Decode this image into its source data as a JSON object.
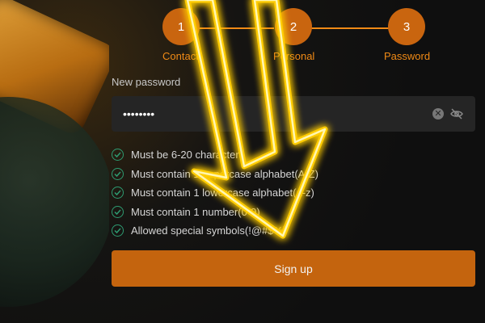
{
  "steps": [
    {
      "number": "1",
      "label": "Contact"
    },
    {
      "number": "2",
      "label": "Personal"
    },
    {
      "number": "3",
      "label": "Password"
    }
  ],
  "form": {
    "password_label": "New password",
    "password_value": "••••••••",
    "rules": [
      "Must be 6-20 characters",
      "Must contain 1 uppercase alphabet(A-Z)",
      "Must contain 1 lowercase alphabet(a-z)",
      "Must contain 1 number(0-9)",
      "Allowed special symbols(!@#$%)"
    ],
    "submit_label": "Sign up"
  },
  "colors": {
    "accent": "#c4640e",
    "step_label": "#f08a16",
    "check": "#2e9b71",
    "arrow_glow": "#ffcc00"
  },
  "icons": {
    "clear": "clear-icon",
    "visibility": "eye-off-icon",
    "check": "check-circle-icon"
  }
}
